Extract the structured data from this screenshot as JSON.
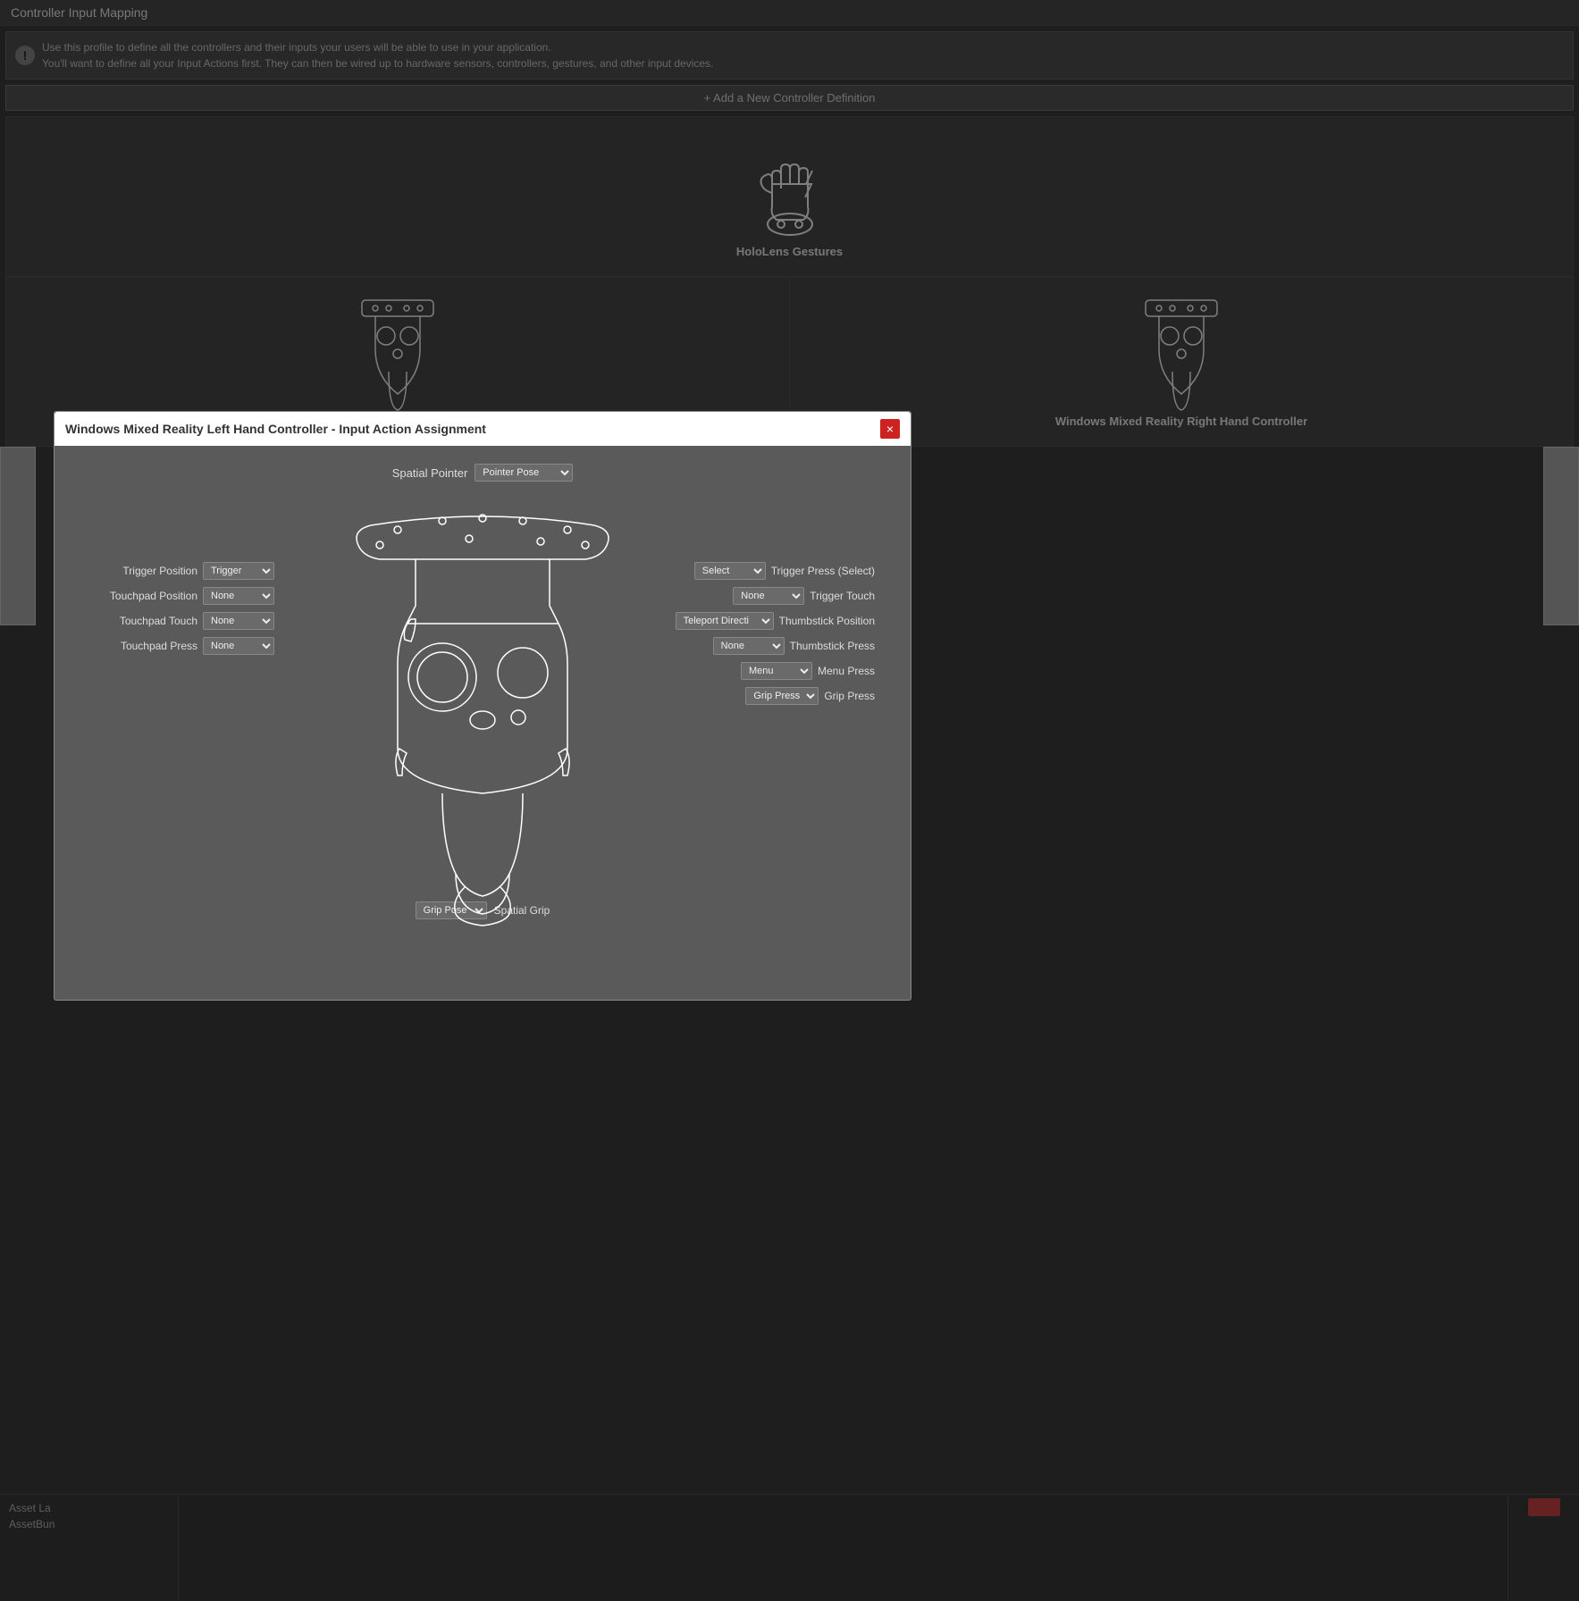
{
  "page": {
    "title": "Controller Input Mapping",
    "info_line1": "Use this profile to define all the controllers and their inputs your users will be able to use in your application.",
    "info_line2": "You'll want to define all your Input Actions first. They can then be wired up to hardware sensors, controllers, gestures, and other input devices.",
    "add_button": "+ Add a New Controller Definition"
  },
  "controllers": [
    {
      "id": "hololens",
      "name": "HoloLens Gestures",
      "type": "single"
    },
    {
      "id": "wmr-left",
      "name": "Windows Mixed Reality Left Hand Controller",
      "type": "left"
    },
    {
      "id": "wmr-right",
      "name": "Windows Mixed Reality Right Hand Controller",
      "type": "right"
    }
  ],
  "modal": {
    "title": "Windows Mixed Reality Left Hand Controller - Input Action Assignment",
    "close_label": "×",
    "spatial_pointer": {
      "label": "Spatial Pointer",
      "dropdown_value": "Pointer Pose"
    },
    "left_mappings": [
      {
        "label": "Trigger Position",
        "value": "Trigger"
      },
      {
        "label": "Touchpad Position",
        "value": "None"
      },
      {
        "label": "Touchpad Touch",
        "value": "None"
      },
      {
        "label": "Touchpad Press",
        "value": "None"
      }
    ],
    "right_mappings": [
      {
        "label": "Trigger Press (Select)",
        "value": "Select"
      },
      {
        "label": "Trigger Touch",
        "value": "None"
      },
      {
        "label": "Thumbstick Position",
        "value": "Teleport Directi"
      },
      {
        "label": "Thumbstick Press",
        "value": "None"
      },
      {
        "label": "Menu Press",
        "value": "Menu"
      },
      {
        "label": "Grip Press",
        "value": "Grip Press"
      }
    ],
    "bottom_mappings": [
      {
        "label": "Spatial Grip",
        "value": "Grip Pose"
      }
    ]
  },
  "asset_panel": {
    "label": "Asset La",
    "sub_label": "AssetBun"
  },
  "colors": {
    "accent_red": "#cc2222",
    "bg_dark": "#3c3c3c",
    "bg_medium": "#484848",
    "bg_light": "#5a5a5a",
    "border": "#666666",
    "text_light": "#eeeeee",
    "text_dim": "#cccccc"
  }
}
